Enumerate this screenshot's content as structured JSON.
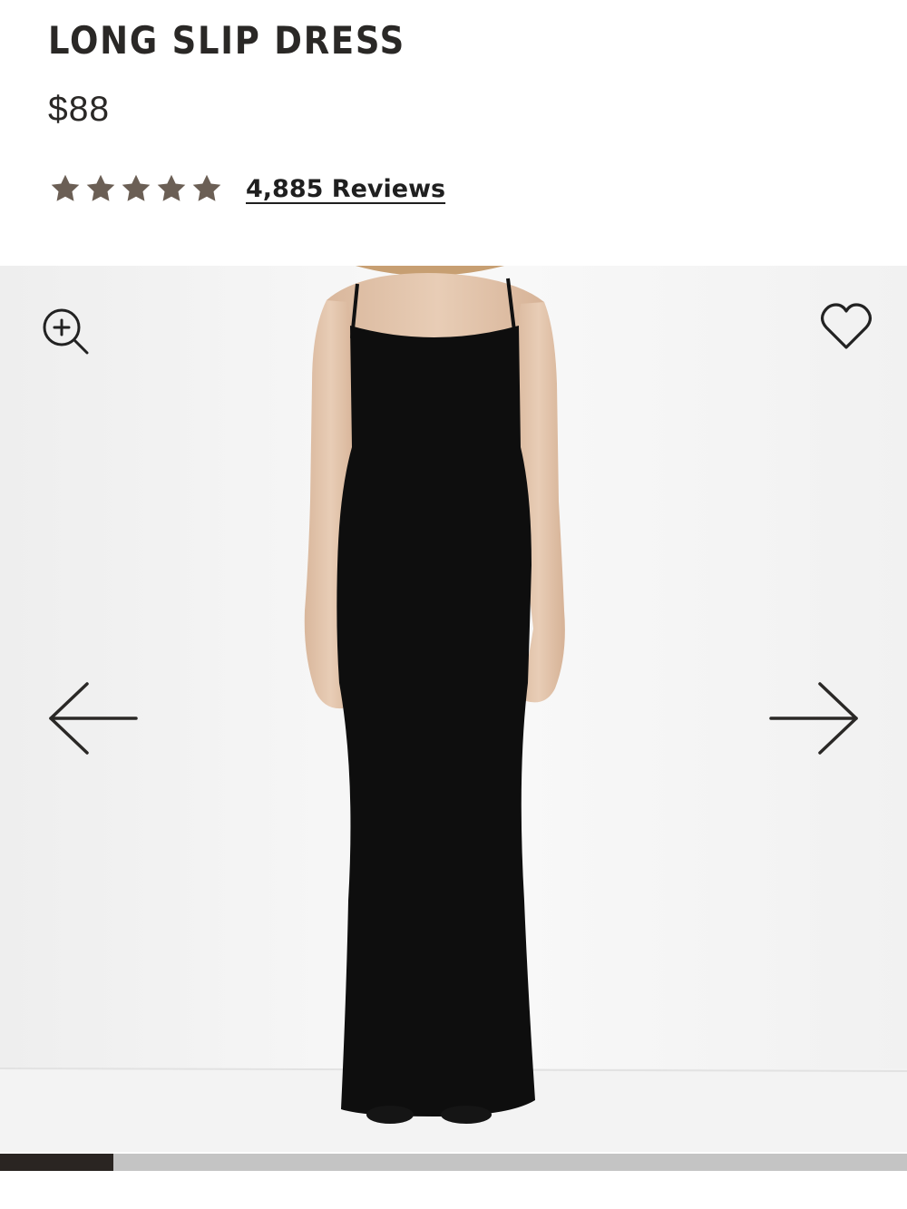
{
  "product": {
    "title": "LONG SLIP DRESS",
    "price": "$88",
    "rating": 5,
    "rating_max": 5,
    "reviews_label": "4,885 Reviews"
  },
  "gallery": {
    "image_subject": "black-long-slip-dress-model-photo",
    "progress_fraction": 0.125,
    "icons": {
      "zoom": "zoom-in-icon",
      "favorite": "heart-icon",
      "previous": "arrow-left-icon",
      "next": "arrow-right-icon"
    }
  },
  "colors": {
    "star": "#6b5f55",
    "text": "#2a2826",
    "progress_fill": "#2a2522",
    "progress_track": "#c4c4c4"
  }
}
